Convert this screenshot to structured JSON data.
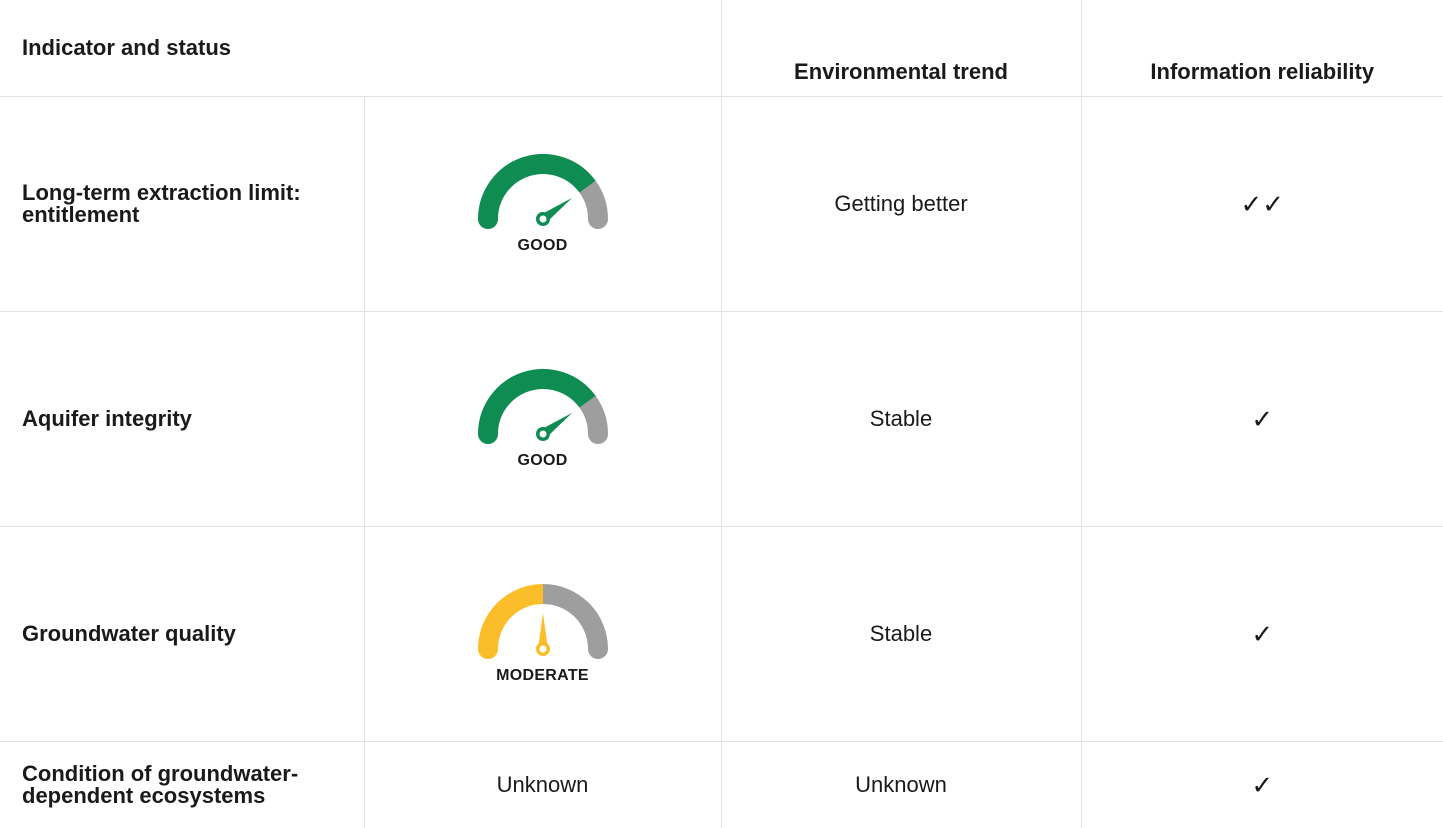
{
  "header": {
    "indicator": "Indicator and status",
    "trend": "Environmental trend",
    "reliability": "Information reliability"
  },
  "rows": [
    {
      "indicator": "Long-term extraction limit: entitlement",
      "status": {
        "type": "gauge",
        "label": "GOOD",
        "level": 0.8,
        "color": "#0f8c52",
        "rest_color": "#9e9e9e"
      },
      "trend": "Getting better",
      "reliability": "✓✓"
    },
    {
      "indicator": "Aquifer integrity",
      "status": {
        "type": "gauge",
        "label": "GOOD",
        "level": 0.8,
        "color": "#0f8c52",
        "rest_color": "#9e9e9e"
      },
      "trend": "Stable",
      "reliability": "✓"
    },
    {
      "indicator": "Groundwater quality",
      "status": {
        "type": "gauge",
        "label": "MODERATE",
        "level": 0.5,
        "color": "#fbbd2a",
        "rest_color": "#9e9e9e"
      },
      "trend": "Stable",
      "reliability": "✓"
    },
    {
      "indicator": "Condition of groundwater-dependent ecosystems",
      "status": {
        "type": "text",
        "label": "Unknown"
      },
      "trend": "Unknown",
      "reliability": "✓"
    }
  ]
}
